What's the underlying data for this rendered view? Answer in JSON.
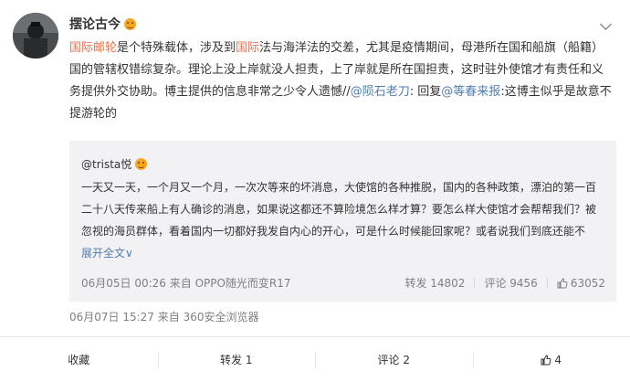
{
  "post": {
    "author": "摆论古今",
    "body": {
      "hl1": "国际邮轮",
      "t1": "是个特殊载体，涉及到",
      "hl2": "国际",
      "t2": "法与海洋法的交差，尤其是疫情期间，母港所在国和船旗（船籍）国的管辖权错综复杂。理论上没上岸就没人担责，上了岸就是所在国担责，这时驻外使馆才有责任和义务提供外交协助。博主提供的信息非常之少令人遗憾//",
      "lk1": "@陨石老刀",
      "t3": ": 回复",
      "lk2": "@等春来报",
      "t4": ":这博主似乎是故意不提游轮的"
    },
    "time": "06月07日 15:27  来自 360安全浏览器"
  },
  "quote": {
    "author": "@trista悦",
    "text": "一天又一天，一个月又一个月，一次次等来的坏消息，大使馆的各种推脱，国内的各种政策，漂泊的第一百二十八天传来船上有人确诊的消息，如果说这都还不算险境怎么样才算？要怎么样大使馆才会帮帮我们？被忽视的海员群体，看着国内一切都好我发自内心的开心，可是什么时候能回家呢？或者说我们到底还能不",
    "more": "展开全文",
    "more_arrow": "∨",
    "time": "06月05日 00:26 来自 OPPO随光而变R17",
    "repost": "转发 14802",
    "comment": "评论 9456",
    "likes": "63052"
  },
  "actions": {
    "collect": "收藏",
    "repost": "转发 1",
    "comment": "评论 2",
    "like": "4"
  },
  "icons": [
    "avatar",
    "smile-emoji-icon",
    "chevron-down-icon",
    "thumbs-up-icon"
  ],
  "colors": {
    "highlight": "#eb7350",
    "link": "#507daf",
    "quote_bg": "#f2f2f5",
    "muted": "#808080"
  }
}
